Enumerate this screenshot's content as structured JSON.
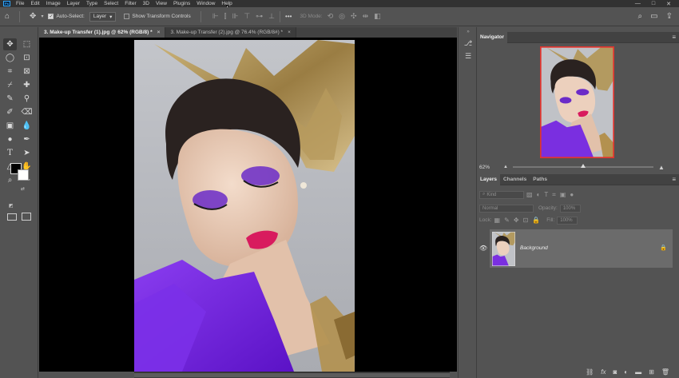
{
  "menubar": {
    "app_icon": "Ps",
    "items": [
      "File",
      "Edit",
      "Image",
      "Layer",
      "Type",
      "Select",
      "Filter",
      "3D",
      "View",
      "Plugins",
      "Window",
      "Help"
    ],
    "window_controls": [
      "—",
      "□",
      "✕"
    ]
  },
  "options_bar": {
    "auto_select_label": "Auto-Select:",
    "auto_select_checked": true,
    "target_value": "Layer",
    "show_transform_label": "Show Transform Controls",
    "show_transform_checked": false,
    "more_label": "•••",
    "mode3d_label": "3D Mode:"
  },
  "document_tabs": [
    {
      "label": "3. Make-up Transfer (1).jpg @ 62% (RGB/8) *",
      "active": true,
      "close": "×"
    },
    {
      "label": "3. Make-up Transfer (2).jpg @ 76.4% (RGB/8#) *",
      "active": false,
      "close": "×"
    }
  ],
  "navigator": {
    "tab_label": "Navigator",
    "zoom_value": "62%",
    "zoom_level": 0.5
  },
  "layers": {
    "tabs": [
      "Layers",
      "Channels",
      "Paths"
    ],
    "filter_value": "Kind",
    "blend_mode": "Normal",
    "opacity_label": "Opacity:",
    "opacity_value": "100%",
    "lock_label": "Lock:",
    "fill_label": "Fill:",
    "fill_value": "100%",
    "layer_name": "Background"
  },
  "colors": {
    "panel_bg": "#535353",
    "menubar_bg": "#323232",
    "canvas_bg": "#000000",
    "accent_purple": "#7a2fe0",
    "layer_selected": "#6b6b6b"
  }
}
